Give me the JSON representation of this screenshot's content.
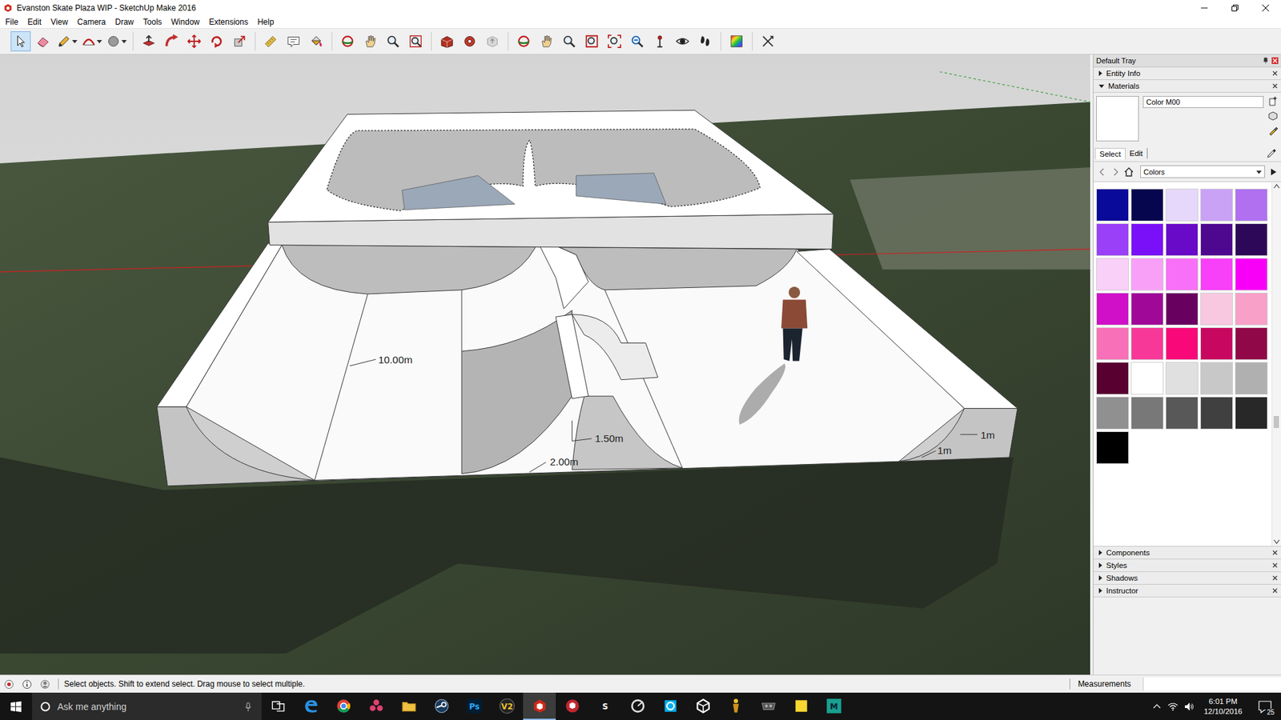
{
  "window": {
    "title": "Evanston Skate Plaza WIP - SketchUp Make 2016"
  },
  "menu": [
    "File",
    "Edit",
    "View",
    "Camera",
    "Draw",
    "Tools",
    "Window",
    "Extensions",
    "Help"
  ],
  "toolbar": [
    {
      "selected": true
    },
    {
      "selected": false
    },
    {
      "selected": false
    },
    {
      "selected": false
    },
    {
      "selected": false
    },
    {
      "selected": false
    },
    {
      "selected": false
    },
    {
      "selected": false
    },
    {
      "selected": false
    },
    {
      "selected": false
    },
    {
      "selected": false
    },
    {
      "selected": false
    },
    {
      "selected": false
    },
    {
      "selected": false
    },
    {
      "selected": false
    },
    {
      "selected": false
    },
    {
      "selected": false
    },
    {
      "selected": false
    },
    {
      "selected": false
    },
    {
      "selected": false
    },
    {
      "selected": false
    },
    {
      "selected": false
    },
    {
      "selected": false
    },
    {
      "selected": false
    },
    {
      "selected": false
    },
    {
      "selected": false
    },
    {
      "selected": false
    },
    {
      "selected": false
    },
    {
      "selected": false
    },
    {
      "selected": false
    },
    {
      "selected": false
    }
  ],
  "viewport": {
    "dimensions": [
      {
        "label": "10.00m"
      },
      {
        "label": "1.50m"
      },
      {
        "label": "2.00m"
      },
      {
        "label": "1m"
      },
      {
        "label": "1m"
      }
    ]
  },
  "tray": {
    "title": "Default Tray",
    "panels": [
      {
        "label": "Entity Info",
        "expanded": false
      },
      {
        "label": "Materials",
        "expanded": true
      }
    ],
    "material": {
      "name": "Color M00",
      "color": "#ffffff"
    },
    "tabs": [
      {
        "label": "Select",
        "selected": true
      },
      {
        "label": "Edit",
        "selected": false
      }
    ],
    "library": "Colors",
    "scroll_position": 0.65,
    "swatches": [
      {
        "color": "#0a0a9a"
      },
      {
        "color": "#06064f"
      },
      {
        "color": "#e6d8fa"
      },
      {
        "color": "#c9a2f5"
      },
      {
        "color": "#b070f0"
      },
      {
        "color": "#9a40f8"
      },
      {
        "color": "#7a10f8"
      },
      {
        "color": "#680ac8"
      },
      {
        "color": "#4e088f"
      },
      {
        "color": "#2e0858"
      },
      {
        "color": "#f8d0f8"
      },
      {
        "color": "#f8a0f8"
      },
      {
        "color": "#f870f8"
      },
      {
        "color": "#f840f8"
      },
      {
        "color": "#f800f8"
      },
      {
        "color": "#d010c8"
      },
      {
        "color": "#a00898"
      },
      {
        "color": "#680060"
      },
      {
        "color": "#f8c8e0"
      },
      {
        "color": "#f8a0c8"
      },
      {
        "color": "#f870b8"
      },
      {
        "color": "#f83898"
      },
      {
        "color": "#f80878"
      },
      {
        "color": "#c80860"
      },
      {
        "color": "#900848"
      },
      {
        "color": "#580030"
      },
      {
        "color": "#ffffff"
      },
      {
        "color": "#e0e0e0"
      },
      {
        "color": "#c8c8c8"
      },
      {
        "color": "#b0b0b0"
      },
      {
        "color": "#909090"
      },
      {
        "color": "#787878"
      },
      {
        "color": "#585858"
      },
      {
        "color": "#404040"
      },
      {
        "color": "#282828"
      },
      {
        "color": "#000000"
      }
    ],
    "lower_panels": [
      {
        "label": "Components",
        "expanded": false
      },
      {
        "label": "Styles",
        "expanded": false
      },
      {
        "label": "Shadows",
        "expanded": false
      },
      {
        "label": "Instructor",
        "expanded": false
      }
    ]
  },
  "status_bar": {
    "message": "Select objects. Shift to extend select. Drag mouse to select multiple.",
    "measurements_label": "Measurements"
  },
  "taskbar": {
    "search_placeholder": "Ask me anything",
    "apps": [
      {
        "active": false
      },
      {
        "active": false
      },
      {
        "active": false
      },
      {
        "active": false
      },
      {
        "active": false
      },
      {
        "label": "Ps",
        "active": false
      },
      {
        "label": "V2",
        "active": false
      },
      {
        "active": true
      },
      {
        "active": false
      },
      {
        "label": "S",
        "active": false
      },
      {
        "active": false
      },
      {
        "active": false
      },
      {
        "active": false
      },
      {
        "active": false
      },
      {
        "active": false
      },
      {
        "active": false
      },
      {
        "label": "M",
        "active": false
      }
    ],
    "time": "6:01 PM",
    "date": "12/10/2016",
    "notifications": "25"
  }
}
